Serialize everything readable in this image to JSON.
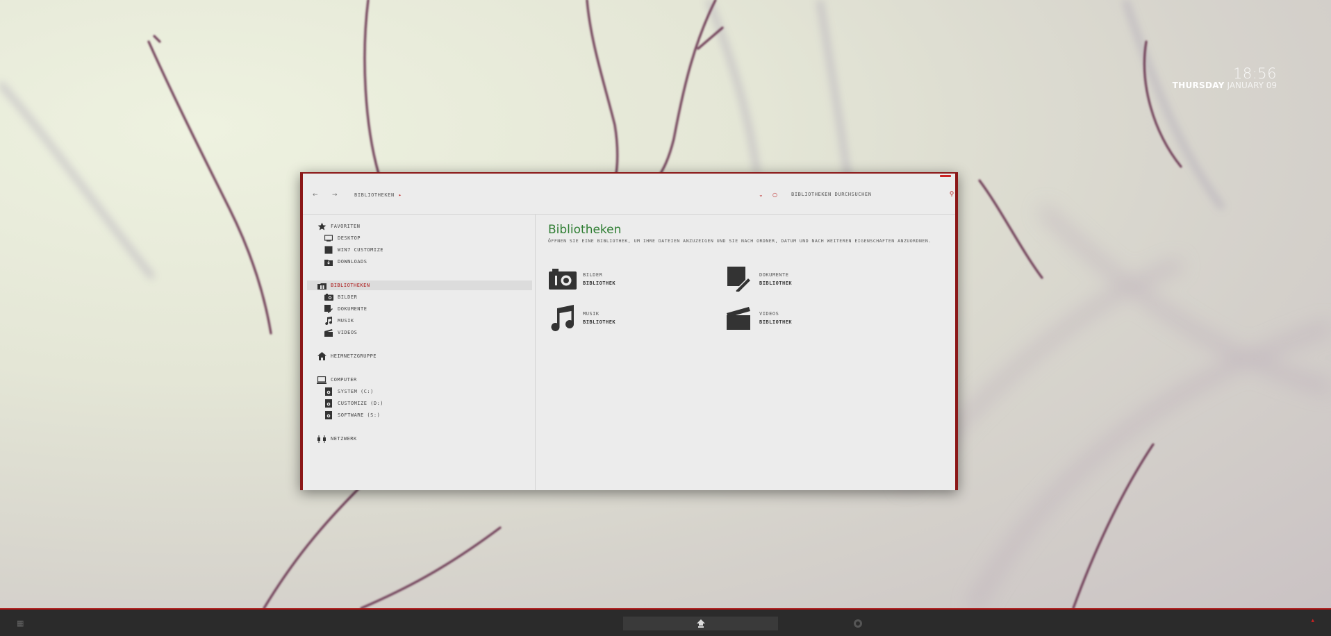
{
  "clock": {
    "time": "18:56",
    "day": "THURSDAY",
    "month_day": "JANUARY 09"
  },
  "colors": {
    "accent": "#8b1717",
    "title_green": "#2e7d32",
    "icon": "#333333"
  },
  "window": {
    "toolbar": {
      "back_icon": "arrow-left-icon",
      "forward_icon": "arrow-right-icon",
      "breadcrumb": "BIBLIOTHEKEN",
      "search_placeholder": "BIBLIOTHEKEN DURCHSUCHEN"
    },
    "sidebar": {
      "favoriten": {
        "label": "FAVORITEN",
        "icon": "star-icon",
        "items": [
          {
            "label": "DESKTOP",
            "icon": "monitor-icon"
          },
          {
            "label": "WIN7 CUSTOMIZE",
            "icon": "square-icon"
          },
          {
            "label": "DOWNLOADS",
            "icon": "download-icon"
          }
        ]
      },
      "bibliotheken": {
        "label": "BIBLIOTHEKEN",
        "icon": "library-icon",
        "items": [
          {
            "label": "BILDER",
            "icon": "camera-icon"
          },
          {
            "label": "DOKUMENTE",
            "icon": "document-icon"
          },
          {
            "label": "MUSIK",
            "icon": "music-icon"
          },
          {
            "label": "VIDEOS",
            "icon": "clapper-icon"
          }
        ]
      },
      "heimnetzgruppe": {
        "label": "HEIMNETZGRUPPE",
        "icon": "home-icon"
      },
      "computer": {
        "label": "COMPUTER",
        "icon": "laptop-icon",
        "items": [
          {
            "label": "SYSTEM (C:)",
            "icon": "drive-icon"
          },
          {
            "label": "CUSTOMIZE (D:)",
            "icon": "drive-icon"
          },
          {
            "label": "SOFTWARE (S:)",
            "icon": "drive-icon"
          }
        ]
      },
      "netzwerk": {
        "label": "NETZWERK",
        "icon": "network-icon"
      }
    },
    "content": {
      "title": "Bibliotheken",
      "subtitle": "ÖFFNEN SIE EINE BIBLIOTHEK, UM IHRE DATEIEN ANZUZEIGEN UND SIE NACH ORDNER, DATUM UND NACH WEITEREN EIGENSCHAFTEN ANZUORDNEN.",
      "libraries": [
        {
          "name": "BILDER",
          "kind": "BIBLIOTHEK",
          "icon": "camera-icon"
        },
        {
          "name": "DOKUMENTE",
          "kind": "BIBLIOTHEK",
          "icon": "document-icon"
        },
        {
          "name": "MUSIK",
          "kind": "BIBLIOTHEK",
          "icon": "music-icon"
        },
        {
          "name": "VIDEOS",
          "kind": "BIBLIOTHEK",
          "icon": "clapper-icon"
        }
      ]
    }
  }
}
